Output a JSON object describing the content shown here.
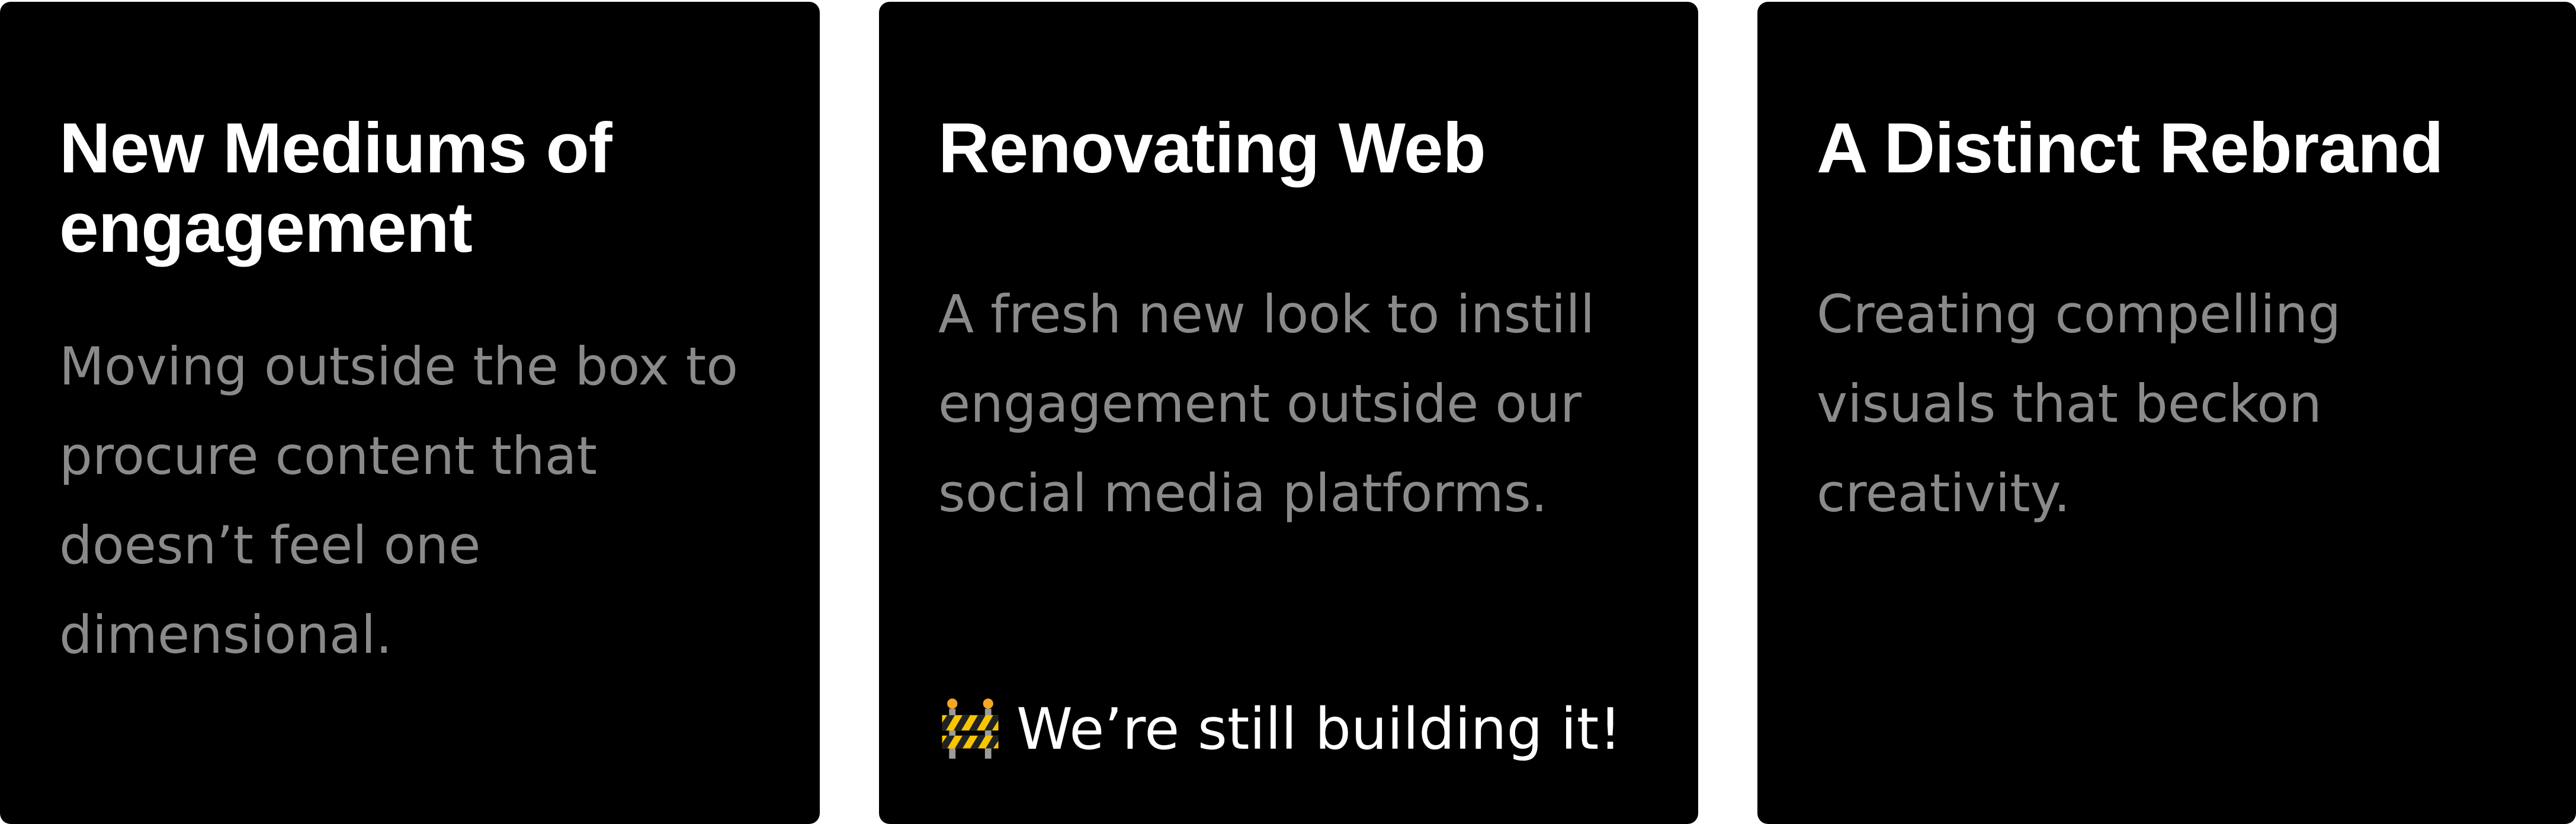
{
  "cards": [
    {
      "title": "New Mediums of engagement",
      "body": "Moving outside the box to procure content that doesn’t feel one dimensional."
    },
    {
      "title": "Renovating Web",
      "body": "A fresh new look to instill engagement outside our social media platforms.",
      "footer": {
        "icon": "construction-barrier-icon",
        "text": "We’re still building it!"
      }
    },
    {
      "title": "A Distinct Rebrand",
      "body": "Creating compelling visuals that beckon creativity."
    }
  ],
  "colors": {
    "card_background": "#000000",
    "page_background": "#ffffff",
    "title": "#ffffff",
    "body": "#8a8a8a",
    "footer": "#ffffff"
  }
}
